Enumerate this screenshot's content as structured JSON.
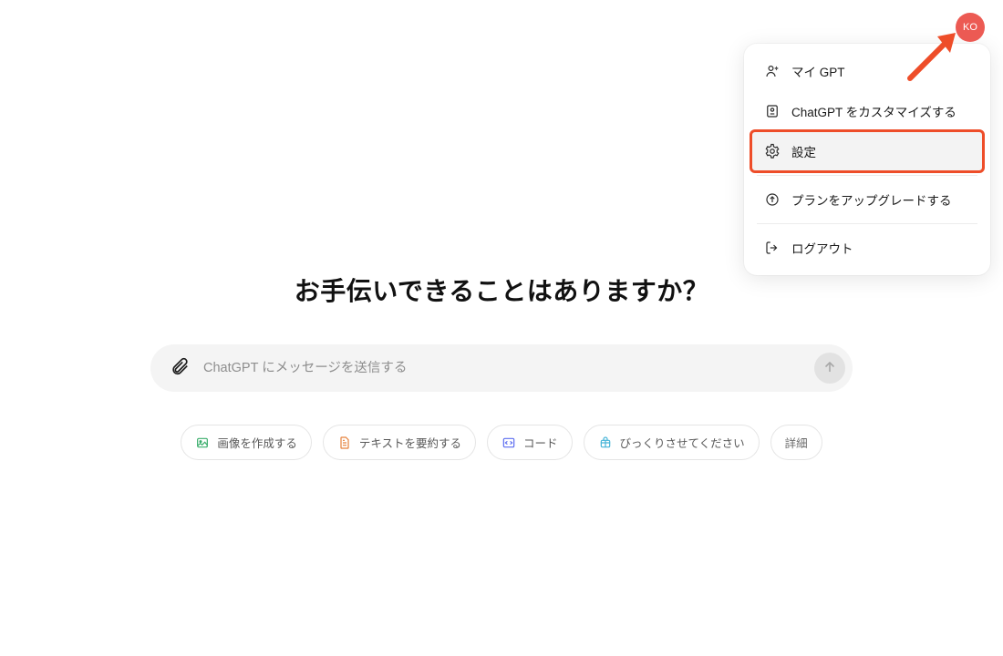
{
  "avatar": {
    "initials": "KO"
  },
  "menu": {
    "items": [
      {
        "id": "my-gpt",
        "label": "マイ GPT"
      },
      {
        "id": "customize",
        "label": "ChatGPT をカスタマイズする"
      },
      {
        "id": "settings",
        "label": "設定",
        "highlighted": true
      },
      {
        "id": "upgrade",
        "label": "プランをアップグレードする",
        "divider_before": true
      },
      {
        "id": "logout",
        "label": "ログアウト",
        "divider_before": true
      }
    ]
  },
  "greeting": "お手伝いできることはありますか？",
  "input": {
    "placeholder": "ChatGPT にメッセージを送信する",
    "value": ""
  },
  "chips": [
    {
      "id": "image",
      "label": "画像を作成する",
      "icon": "image-icon",
      "color": "#3bae6c"
    },
    {
      "id": "summarize",
      "label": "テキストを要約する",
      "icon": "doc-icon",
      "color": "#e6813b"
    },
    {
      "id": "code",
      "label": "コード",
      "icon": "code-icon",
      "color": "#5d6ef0"
    },
    {
      "id": "surprise",
      "label": "びっくりさせてください",
      "icon": "sparkle-icon",
      "color": "#47b5d8"
    },
    {
      "id": "more",
      "label": "詳細",
      "icon": null,
      "color": null
    }
  ],
  "annotation": {
    "arrow_color": "#ee4d29",
    "highlight_color": "#ee4d29"
  }
}
